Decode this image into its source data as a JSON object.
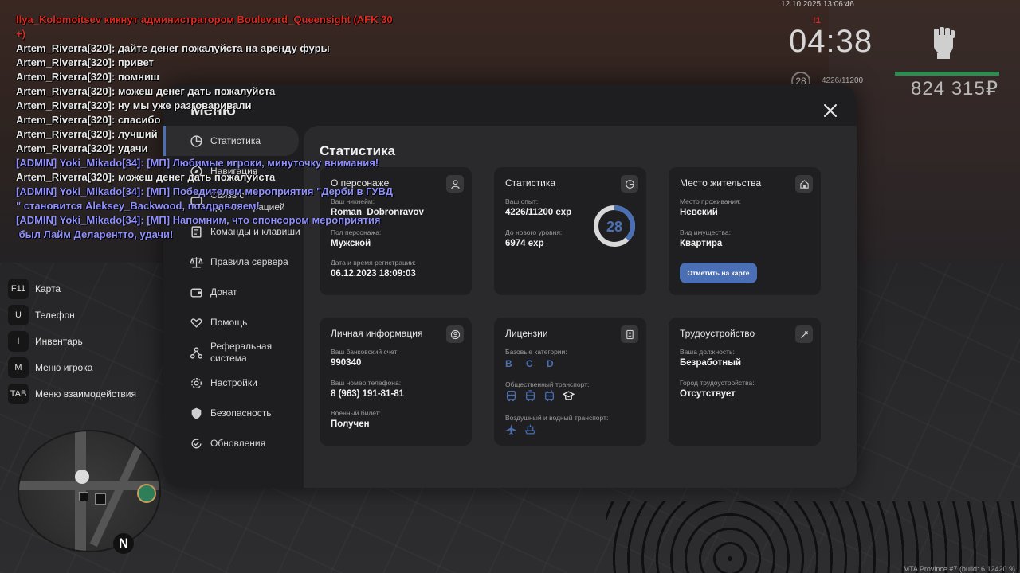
{
  "hud": {
    "datetime": "12.10.2025 13:06:46",
    "wanted": "!1",
    "time": "04:38",
    "level": "28",
    "exp": "4226/11200",
    "money": "824 315₽",
    "build": "MTA Province #7 (build: 6.12420.9)"
  },
  "chat": [
    {
      "text": "Ilya_Kolomoitsev кикнут администратором Boulevard_Queensight (AFK 30\n+)",
      "style": "red"
    },
    {
      "text": "Artem_Riverra[320]: дайте денег пожалуйста на аренду фуры",
      "style": "white"
    },
    {
      "text": "Artem_Riverra[320]: привет",
      "style": "white"
    },
    {
      "text": "Artem_Riverra[320]: помниш",
      "style": "white"
    },
    {
      "text": "Artem_Riverra[320]: можеш денег дать пожалуйста",
      "style": "white"
    },
    {
      "text": "Artem_Riverra[320]: ну мы уже разговаривали",
      "style": "white"
    },
    {
      "text": "Artem_Riverra[320]: спасибо",
      "style": "white"
    },
    {
      "text": "Artem_Riverra[320]: лучший",
      "style": "white"
    },
    {
      "text": "Artem_Riverra[320]: удачи",
      "style": "white"
    },
    {
      "text": "[ADMIN] Yoki_Mikado[34]: [МП] Любимые игроки, минуточку внимания!",
      "style": "admin"
    },
    {
      "text": "Artem_Riverra[320]: можеш денег дать пожалуйста",
      "style": "white"
    },
    {
      "text": "[ADMIN] Yoki_Mikado[34]: [МП] Победителем мероприятия \"Дерби в ГУВД\n\" становится Aleksey_Backwood, поздравляем!",
      "style": "admin"
    },
    {
      "text": "[ADMIN] Yoki_Mikado[34]: [МП] Напомним, что спонсором мероприятия\n был Лайм Деларентто, удачи!",
      "style": "admin"
    }
  ],
  "keybinds": [
    {
      "key": "F11",
      "label": "Карта"
    },
    {
      "key": "U",
      "label": "Телефон"
    },
    {
      "key": "I",
      "label": "Инвентарь"
    },
    {
      "key": "M",
      "label": "Меню игрока"
    },
    {
      "key": "TAB",
      "label": "Меню взаимодействия"
    }
  ],
  "menu": {
    "title": "Меню",
    "nav": [
      {
        "label": "Статистика",
        "icon": "pie-chart-icon",
        "active": true
      },
      {
        "label": "Навигация",
        "icon": "compass-icon"
      },
      {
        "label": "Связь с администрацией",
        "icon": "chat-icon"
      },
      {
        "label": "Команды и клавиши",
        "icon": "document-icon"
      },
      {
        "label": "Правила сервера",
        "icon": "scales-icon"
      },
      {
        "label": "Донат",
        "icon": "wallet-icon"
      },
      {
        "label": "Помощь",
        "icon": "heart-hand-icon"
      },
      {
        "label": "Реферальная система",
        "icon": "network-icon"
      },
      {
        "label": "Настройки",
        "icon": "gear-icon"
      },
      {
        "label": "Безопасность",
        "icon": "shield-icon"
      },
      {
        "label": "Обновления",
        "icon": "refresh-check-icon"
      }
    ],
    "content_title": "Статистика",
    "cards": {
      "about": {
        "title": "О персонаже",
        "nick_label": "Ваш никнейм:",
        "nick": "Roman_Dobronravov",
        "gender_label": "Пол персонажа:",
        "gender": "Мужской",
        "reg_label": "Дата и время регистрации:",
        "reg": "06.12.2023 18:09:03"
      },
      "stats": {
        "title": "Статистика",
        "exp_label": "Ваш опыт:",
        "exp": "4226/11200 exp",
        "next_label": "До нового уровня:",
        "next": "6974 exp",
        "level": "28",
        "progress": 0.377
      },
      "residence": {
        "title": "Место жительства",
        "place_label": "Место проживания:",
        "place": "Невский",
        "property_label": "Вид имущества:",
        "property": "Квартира",
        "button": "Отметить на карте"
      },
      "personal": {
        "title": "Личная информация",
        "bank_label": "Ваш банковский счет:",
        "bank": "990340",
        "phone_label": "Ваш номер телефона:",
        "phone": "8 (963) 191-81-81",
        "military_label": "Военный билет:",
        "military": "Получен"
      },
      "licenses": {
        "title": "Лицензии",
        "base_label": "Базовые категории:",
        "base": "B C D",
        "public_label": "Общественный транспорт:",
        "air_label": "Воздушный и водный транспорт:"
      },
      "job": {
        "title": "Трудоустройство",
        "position_label": "Ваша должность:",
        "position": "Безработный",
        "city_label": "Город трудоустройства:",
        "city": "Отсутствует"
      }
    }
  },
  "colors": {
    "accent": "#4b6fb5",
    "health": "#2d8c52",
    "chat_red": "#e0281f",
    "chat_admin": "#8f8fff"
  }
}
